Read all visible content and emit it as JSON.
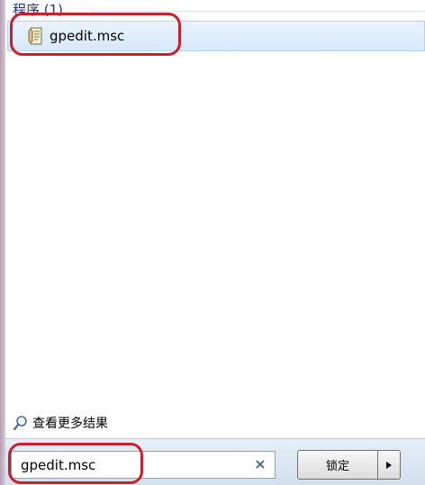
{
  "group": {
    "header": "程序 (1)"
  },
  "results": [
    {
      "label": "gpedit.msc",
      "icon": "msc-file-icon"
    }
  ],
  "see_more": {
    "label": "查看更多结果",
    "icon": "search-icon"
  },
  "search": {
    "value": "gpedit.msc",
    "clear_icon": "close-icon"
  },
  "power": {
    "button_label": "锁定",
    "arrow_icon": "triangle-right-icon"
  },
  "colors": {
    "header_text": "#1e3287",
    "selection": "#d6e9fb",
    "annotation": "#cc1f2c"
  }
}
